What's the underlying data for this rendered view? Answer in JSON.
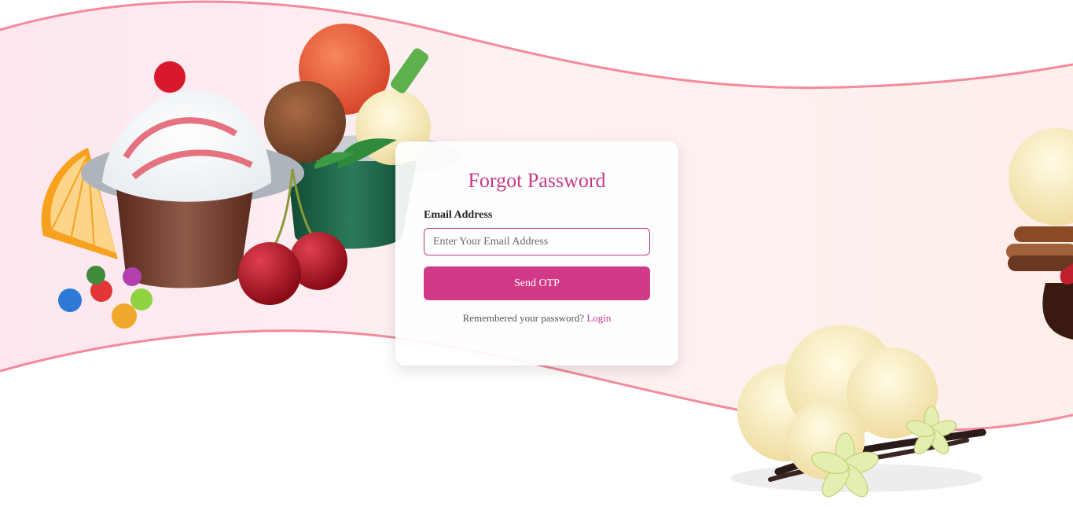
{
  "form": {
    "title": "Forgot Password",
    "email_label": "Email Address",
    "email_placeholder": "Enter Your Email Address",
    "email_value": "",
    "submit_label": "Send OTP",
    "footer_prompt": "Remembered your password?",
    "login_link": "Login"
  },
  "colors": {
    "accent": "#d13a87",
    "title": "#c63a86",
    "wave_stroke": "#f48a9b",
    "band_fill": "#fdeeee"
  },
  "decor": {
    "left_image": "ice-cream-cups-illustration",
    "right_image": "vanilla-ice-cream-scoops-illustration",
    "background": "pink-wave-band"
  }
}
